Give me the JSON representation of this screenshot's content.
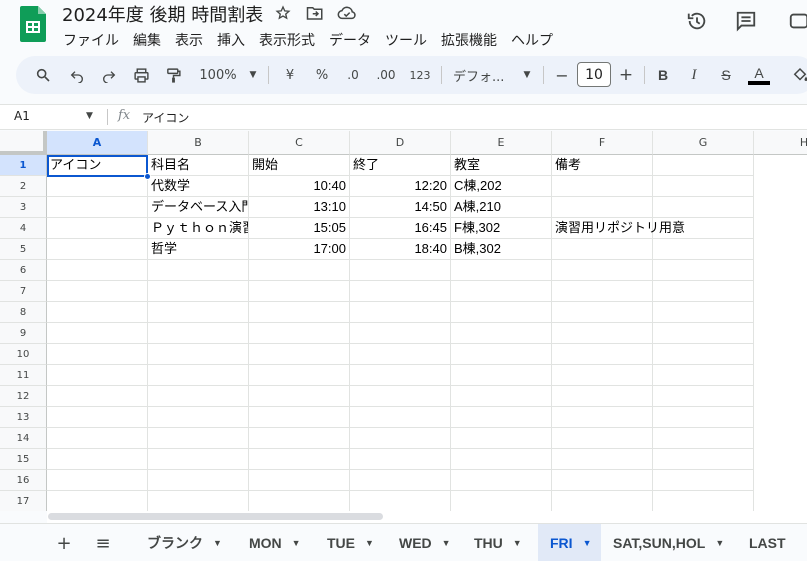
{
  "doc": {
    "title": "2024年度 後期 時間割表",
    "icons": [
      "star-icon",
      "move-to-folder-icon",
      "cloud-saved-icon"
    ]
  },
  "menu": [
    "ファイル",
    "編集",
    "表示",
    "挿入",
    "表示形式",
    "データ",
    "ツール",
    "拡張機能",
    "ヘルプ"
  ],
  "toolbar": {
    "zoom": "100%",
    "currency": "¥",
    "percent": "%",
    "dec_decrease": ".0",
    "dec_increase": ".00",
    "number_format": "123",
    "font": "デフォ...",
    "font_size": "10",
    "minus": "−",
    "plus": "+",
    "bold": "B",
    "italic": "I",
    "strike": "S",
    "text_color": "A",
    "text_color_value": "#000000"
  },
  "formula_bar": {
    "cell_ref": "A1",
    "fx": "fx",
    "content": "アイコン"
  },
  "grid": {
    "columns": [
      "A",
      "B",
      "C",
      "D",
      "E",
      "F",
      "G",
      "H"
    ],
    "rows": [
      "1",
      "2",
      "3",
      "4",
      "5",
      "6",
      "7",
      "8",
      "9",
      "10",
      "11",
      "12",
      "13",
      "14",
      "15",
      "16",
      "17"
    ],
    "cells": [
      [
        "アイコン",
        "科目名",
        "開始",
        "終了",
        "教室",
        "備考",
        ""
      ],
      [
        "",
        "代数学",
        "10:40",
        "12:20",
        "C棟,202",
        "",
        ""
      ],
      [
        "",
        "データベース入門",
        "13:10",
        "14:50",
        "A棟,210",
        "",
        ""
      ],
      [
        "",
        "Ｐｙｔｈｏｎ演習",
        "15:05",
        "16:45",
        "F棟,302",
        "演習用リポジトリ用意",
        ""
      ],
      [
        "",
        "哲学",
        "17:00",
        "18:40",
        "B棟,302",
        "",
        ""
      ]
    ],
    "selected": "A1"
  },
  "sheets": {
    "add": "+",
    "all": "≡",
    "tabs": [
      "ブランク",
      "MON",
      "TUE",
      "WED",
      "THU",
      "FRI",
      "SAT,SUN,HOL",
      "LAST"
    ],
    "active": "FRI"
  },
  "colors": {
    "accent": "#0b57d0",
    "sheets_green": "#0f9d58",
    "selection_header": "#d3e3fd",
    "toolbar_bg": "#edf2fa"
  }
}
